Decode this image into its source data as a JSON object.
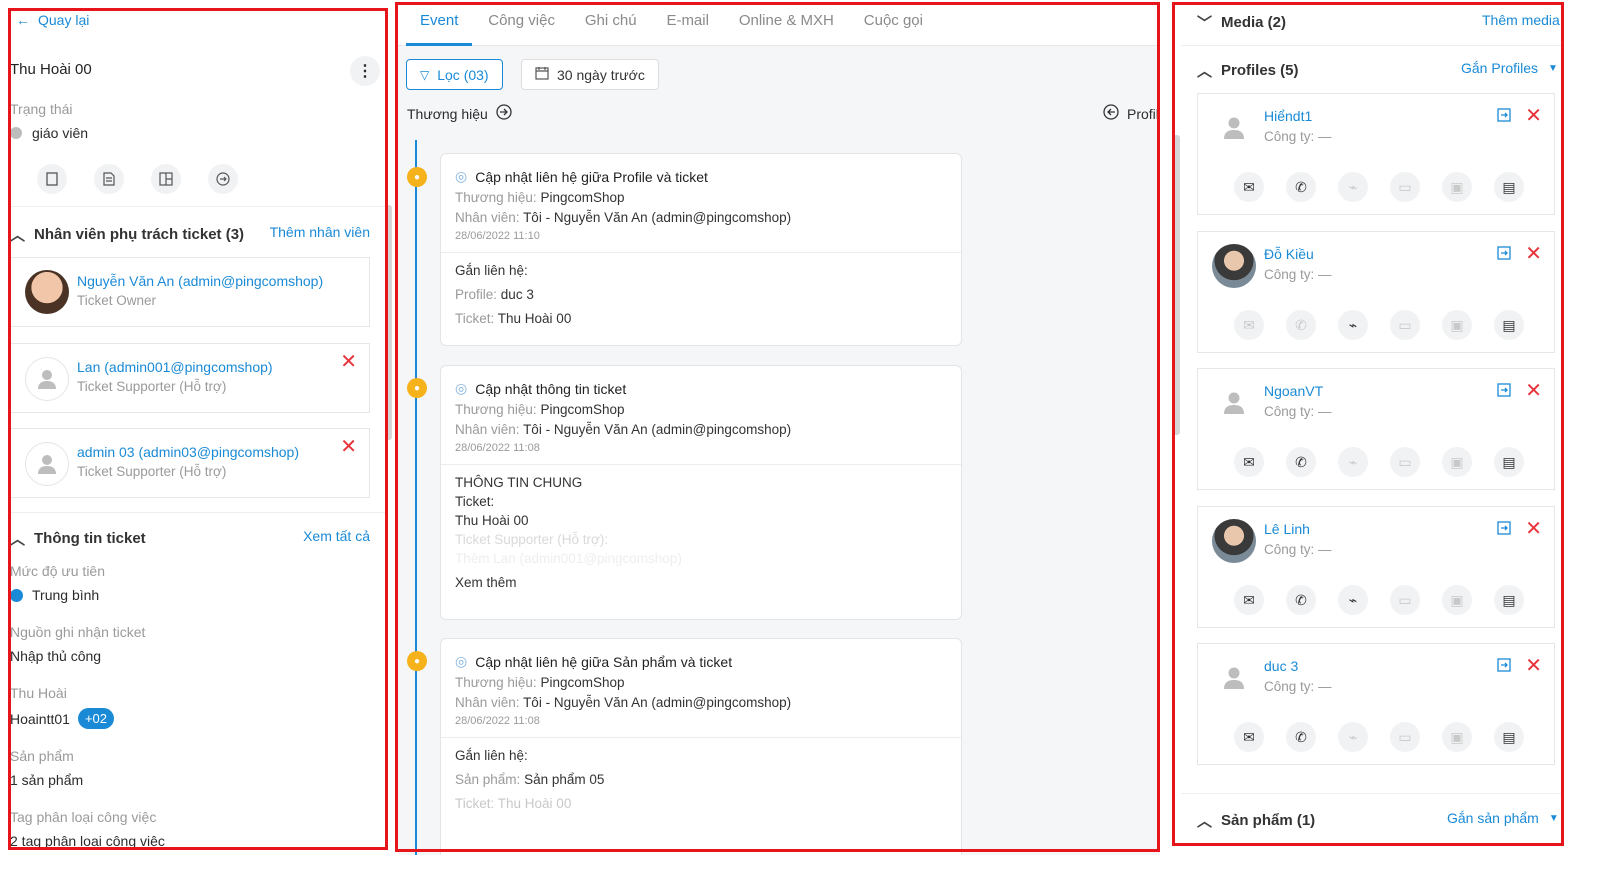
{
  "left": {
    "back": "Quay lại",
    "title": "Thu Hoài 00",
    "status_label": "Trạng thái",
    "status_value": "giáo viên",
    "staff_section": {
      "title": "Nhân viên phụ trách ticket (3)",
      "action": "Thêm nhân viên"
    },
    "staff": [
      {
        "name": "Nguyễn Văn An (admin@pingcomshop)",
        "role": "Ticket Owner"
      },
      {
        "name": "Lan (admin001@pingcomshop)",
        "role": "Ticket Supporter (Hỗ trợ)"
      },
      {
        "name": "admin 03 (admin03@pingcomshop)",
        "role": "Ticket Supporter (Hỗ trợ)"
      }
    ],
    "info_section": {
      "title": "Thông tin ticket",
      "action": "Xem tất cả"
    },
    "fields": [
      {
        "label": "Mức độ ưu tiên",
        "value": "Trung bình"
      },
      {
        "label": "Nguồn ghi nhận ticket",
        "value": "Nhập thủ công"
      },
      {
        "label": "Thu Hoài",
        "value": "Hoaintt01",
        "badge": "+02"
      },
      {
        "label": "Sản phẩm",
        "value": "1 sản phẩm"
      },
      {
        "label": "Tag phân loại công việc",
        "value": "2 tag phân loại công việc"
      }
    ],
    "colors": {
      "priority_dot": "#1a8ad6",
      "status_dot": "#bdbdbd"
    }
  },
  "mid": {
    "tabs": [
      "Event",
      "Công việc",
      "Ghi chú",
      "E-mail",
      "Online & MXH",
      "Cuộc gọi"
    ],
    "filter": "Lọc (03)",
    "date_filter": "30 ngày trước",
    "brand_label": "Thương hiệu",
    "profile_label": "Profile",
    "events": [
      {
        "title": "Cập nhật liên hệ giữa Profile và ticket",
        "brand_k": "Thương hiệu:",
        "brand_v": "PingcomShop",
        "staff_k": "Nhân viên:",
        "staff_v": "Tôi - Nguyễn Văn An (admin@pingcomshop)",
        "date": "28/06/2022 11:10",
        "body_title": "Gắn liên hệ:",
        "lines": [
          {
            "k": "Profile:",
            "v": "duc 3"
          },
          {
            "k": "Ticket:",
            "v": "Thu Hoài 00"
          }
        ]
      },
      {
        "title": "Cập nhật thông tin ticket",
        "brand_k": "Thương hiệu:",
        "brand_v": "PingcomShop",
        "staff_k": "Nhân viên:",
        "staff_v": "Tôi - Nguyễn Văn An (admin@pingcomshop)",
        "date": "28/06/2022 11:08",
        "body_title": "THÔNG TIN CHUNG",
        "l1": "Ticket:",
        "l2": "Thu Hoài 00",
        "l3": "Ticket Supporter (Hỗ trợ):",
        "l4": "Thêm Lan (admin001@pingcomshop)",
        "more": "Xem thêm"
      },
      {
        "title": "Cập nhật liên hệ giữa Sản phẩm và ticket",
        "brand_k": "Thương hiệu:",
        "brand_v": "PingcomShop",
        "staff_k": "Nhân viên:",
        "staff_v": "Tôi - Nguyễn Văn An (admin@pingcomshop)",
        "date": "28/06/2022 11:08",
        "body_title": "Gắn liên hệ:",
        "lines": [
          {
            "k": "Sản phẩm:",
            "v": "Sản phẩm 05"
          },
          {
            "k": "Ticket:",
            "v": "Thu Hoài 00"
          }
        ]
      }
    ],
    "colors": {
      "accent": "#1a8ad6",
      "event_dot": "#f5b21b"
    }
  },
  "right": {
    "media": {
      "title": "Media (2)",
      "action": "Thêm media"
    },
    "profiles": {
      "title": "Profiles (5)",
      "action": "Gắn Profiles"
    },
    "company_label": "Công ty: —",
    "profile_list": [
      {
        "name": "Hiểndt1",
        "avatar": "default"
      },
      {
        "name": "Đỗ Kiều",
        "avatar": "photo"
      },
      {
        "name": "NgoanVT",
        "avatar": "default"
      },
      {
        "name": "Lê Linh",
        "avatar": "photo"
      },
      {
        "name": "duc 3",
        "avatar": "default"
      }
    ],
    "products": {
      "title": "Sản phẩm (1)",
      "action": "Gắn sản phẩm"
    }
  }
}
